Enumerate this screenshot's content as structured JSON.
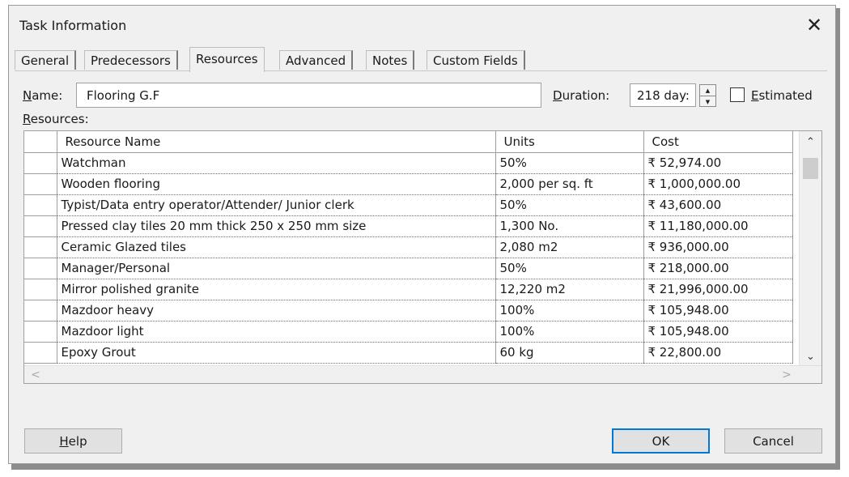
{
  "dialog": {
    "title": "Task Information",
    "close_glyph": "✕"
  },
  "tabs": [
    {
      "label": "General"
    },
    {
      "label": "Predecessors"
    },
    {
      "label": "Resources",
      "active": true
    },
    {
      "label": "Advanced"
    },
    {
      "label": "Notes"
    },
    {
      "label": "Custom Fields"
    }
  ],
  "form": {
    "name_label_key": "N",
    "name_label_rest": "ame:",
    "name_value": "Flooring G.F",
    "duration_label_key": "D",
    "duration_label_rest": "uration:",
    "duration_value": "218 day:",
    "estimated_label_key": "E",
    "estimated_label_rest": "stimated",
    "estimated_checked": false,
    "resources_label_key": "R",
    "resources_label_rest": "esources:"
  },
  "resources_table": {
    "columns": [
      "Resource Name",
      "Units",
      "Cost"
    ],
    "rows": [
      {
        "name": "Watchman",
        "units": "50%",
        "cost": "₹ 52,974.00"
      },
      {
        "name": "Wooden flooring",
        "units": "2,000 per sq. ft",
        "cost": "₹ 1,000,000.00"
      },
      {
        "name": "Typist/Data entry operator/Attender/ Junior clerk",
        "units": "50%",
        "cost": "₹ 43,600.00"
      },
      {
        "name": "Pressed clay tiles 20 mm thick 250 x 250 mm size",
        "units": "1,300 No.",
        "cost": "₹ 11,180,000.00"
      },
      {
        "name": "Ceramic Glazed tiles",
        "units": "2,080 m2",
        "cost": "₹ 936,000.00"
      },
      {
        "name": "Manager/Personal",
        "units": "50%",
        "cost": "₹ 218,000.00"
      },
      {
        "name": "Mirror polished granite",
        "units": "12,220 m2",
        "cost": "₹ 21,996,000.00"
      },
      {
        "name": "Mazdoor heavy",
        "units": "100%",
        "cost": "₹ 105,948.00"
      },
      {
        "name": "Mazdoor light",
        "units": "100%",
        "cost": "₹ 105,948.00"
      },
      {
        "name": "Epoxy Grout",
        "units": "60 kg",
        "cost": "₹ 22,800.00"
      }
    ]
  },
  "icons": {
    "close": "close-icon",
    "spin_up": "triangle-up-icon",
    "spin_down": "triangle-down-icon",
    "scroll_up": "chevron-up-icon",
    "scroll_down": "chevron-down-icon",
    "scroll_left": "chevron-left-icon",
    "scroll_right": "chevron-right-icon"
  },
  "glyphs": {
    "up": "▲",
    "down": "▼",
    "chev_up": "⌃",
    "chev_down": "⌄",
    "left": "<",
    "right": ">"
  },
  "buttons": {
    "help_key": "H",
    "help_rest": "elp",
    "ok": "OK",
    "cancel": "Cancel"
  },
  "colors": {
    "accent": "#0078d7",
    "dialog_bg": "#f0f0f0"
  }
}
